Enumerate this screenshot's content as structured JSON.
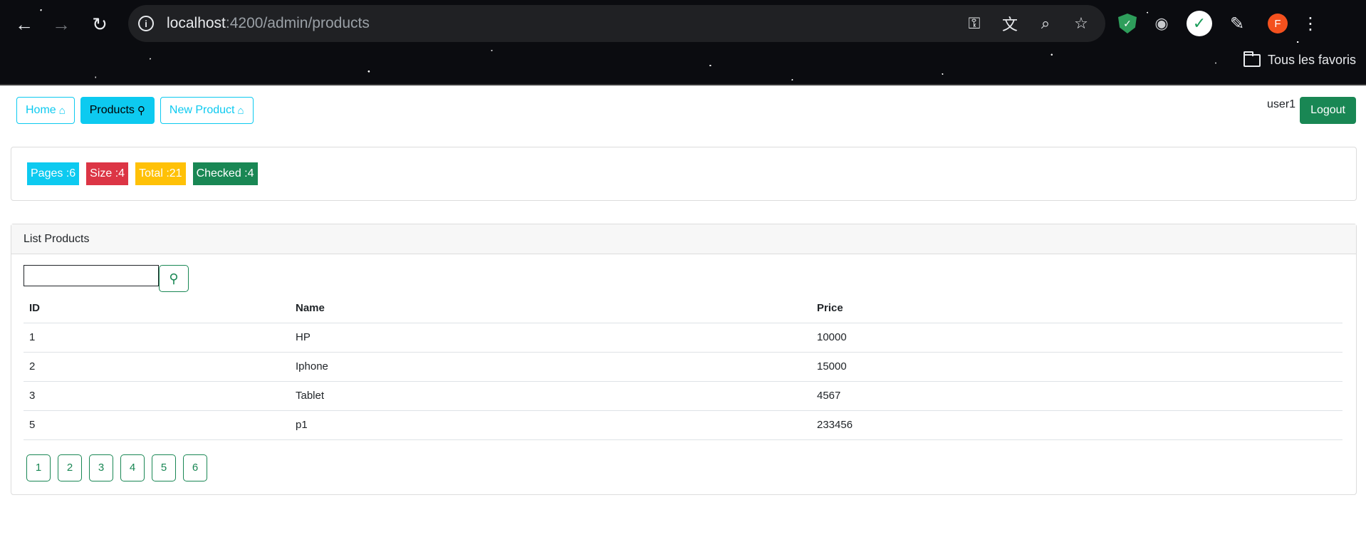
{
  "browser": {
    "url_host": "localhost",
    "url_path": ":4200/admin/products",
    "profile_initial": "F",
    "bookmarks_label": "Tous les favoris"
  },
  "nav": {
    "home_label": "Home",
    "products_label": "Products",
    "new_product_label": "New Product",
    "username": "user1",
    "logout_label": "Logout"
  },
  "stats": {
    "pages": "Pages :6",
    "size": "Size :4",
    "total": "Total :21",
    "checked": "Checked :4"
  },
  "products": {
    "title": "List Products",
    "search_value": "",
    "columns": [
      "ID",
      "Name",
      "Price"
    ],
    "rows": [
      {
        "id": "1",
        "name": "HP",
        "price": "10000"
      },
      {
        "id": "2",
        "name": "Iphone",
        "price": "15000"
      },
      {
        "id": "3",
        "name": "Tablet",
        "price": "4567"
      },
      {
        "id": "5",
        "name": "p1",
        "price": "233456"
      }
    ],
    "pages": [
      "1",
      "2",
      "3",
      "4",
      "5",
      "6"
    ]
  },
  "colors": {
    "info": "#0dcaf0",
    "danger": "#dc3545",
    "warning": "#ffc107",
    "success": "#198754"
  }
}
